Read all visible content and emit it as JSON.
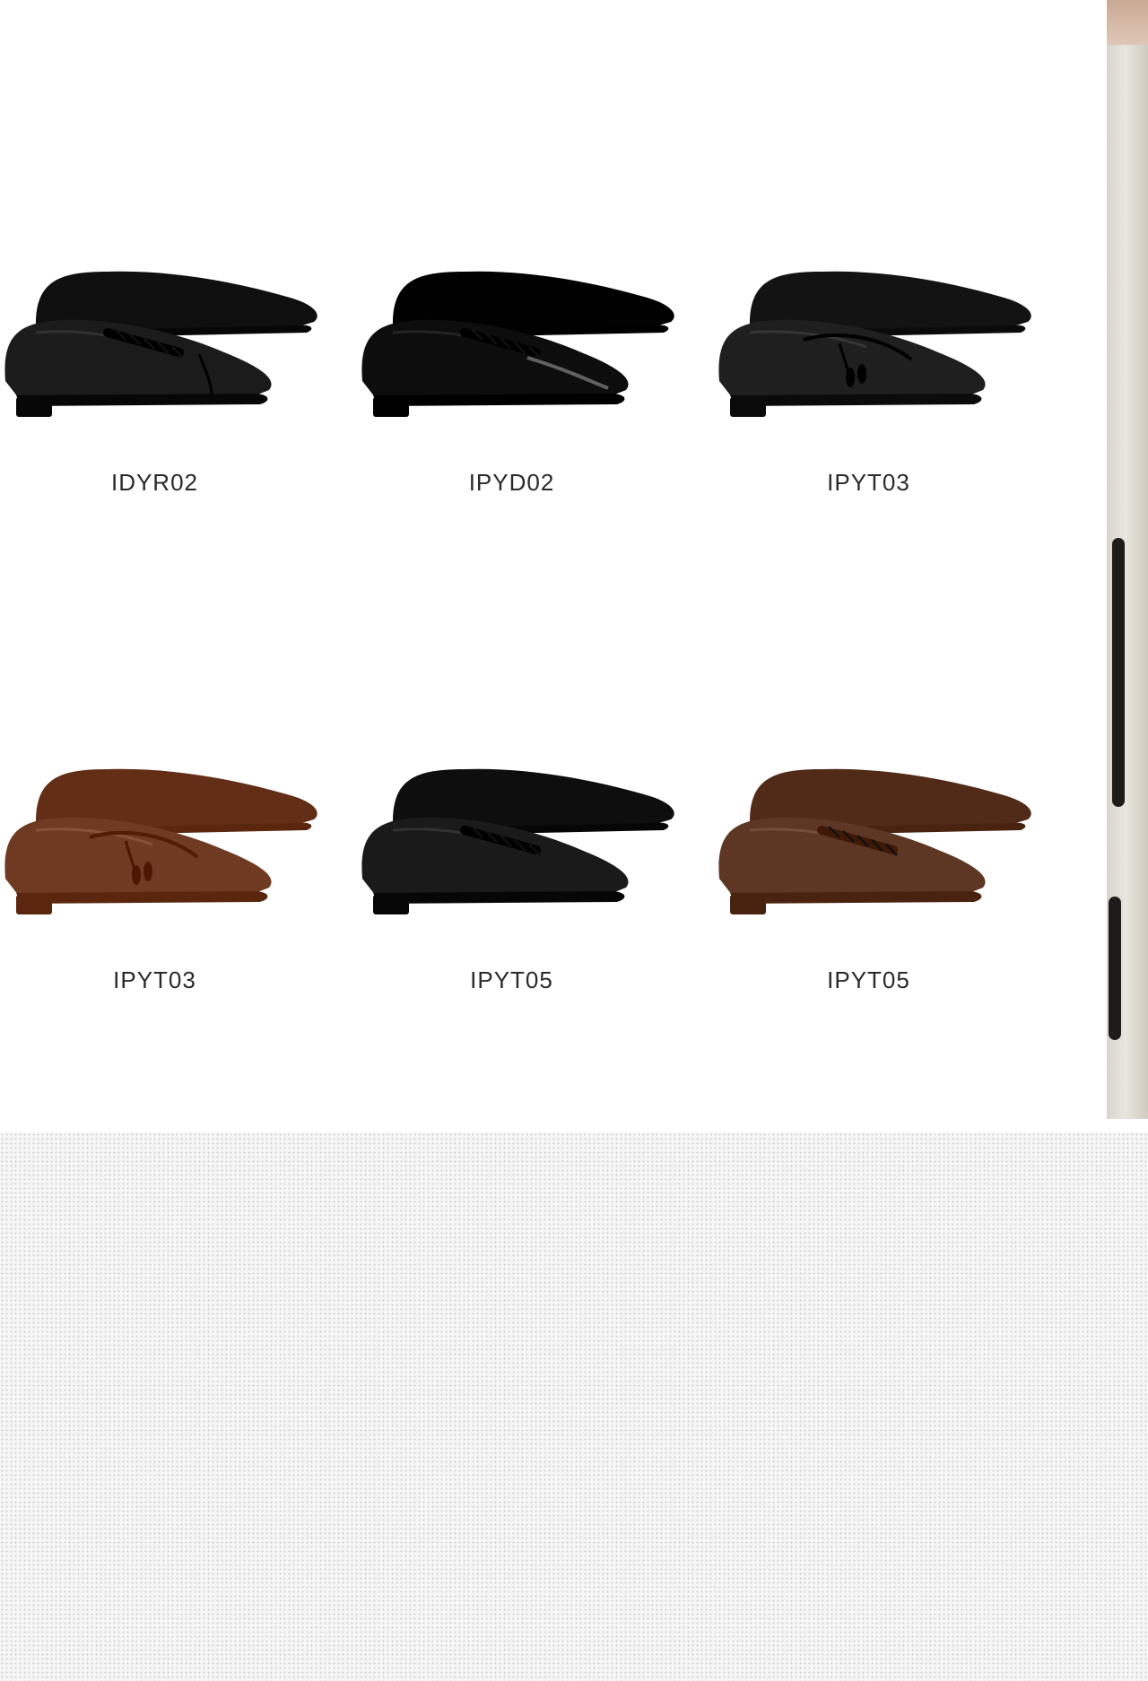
{
  "products": [
    {
      "code": "IDYR02",
      "style": "cap-toe derby",
      "color": "#1b1b1b",
      "finish": "matte",
      "icon": "shoe-oxford-icon"
    },
    {
      "code": "IPYD02",
      "style": "derby",
      "color": "#0d0d0d",
      "finish": "patent",
      "icon": "shoe-derby-icon"
    },
    {
      "code": "IPYT03",
      "style": "tassel loafer",
      "color": "#1f1f1f",
      "finish": "pebbled",
      "icon": "shoe-loafer-icon"
    },
    {
      "code": "IPYT03",
      "style": "tassel loafer",
      "color": "#6e3a22",
      "finish": "pebbled",
      "icon": "shoe-loafer-icon"
    },
    {
      "code": "IPYT05",
      "style": "derby",
      "color": "#1a1a1a",
      "finish": "matte",
      "icon": "shoe-derby-icon"
    },
    {
      "code": "IPYT05",
      "style": "derby",
      "color": "#5e3624",
      "finish": "matte",
      "icon": "shoe-derby-icon"
    }
  ],
  "colors": {
    "label_text": "#2a2a2a",
    "background": "#ffffff",
    "pattern_bg": "#f6f6f6",
    "pattern_dot": "#cfcfcf"
  }
}
